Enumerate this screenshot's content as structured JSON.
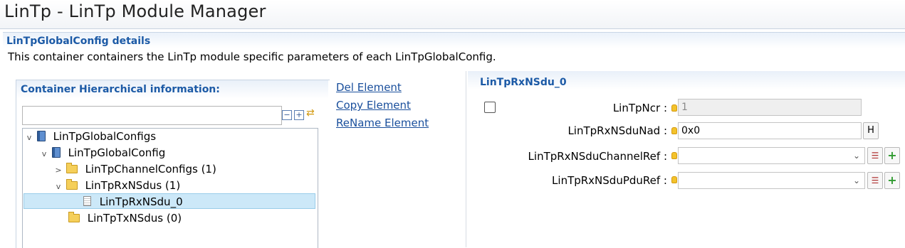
{
  "window": {
    "title": "LinTp - LinTp Module Manager"
  },
  "details": {
    "title": "LinTpGlobalConfig details",
    "description": "This container containers the LinTp module specific parameters of each LinTpGlobalConfig."
  },
  "left_panel": {
    "title": "Container Hierarchical information:",
    "search": {
      "value": "",
      "placeholder": ""
    },
    "tree": [
      {
        "label": "LinTpGlobalConfigs",
        "icon": "book-icon",
        "expanded": true,
        "level": 0
      },
      {
        "label": "LinTpGlobalConfig",
        "icon": "book-icon",
        "expanded": true,
        "level": 1
      },
      {
        "label": "LinTpChannelConfigs (1)",
        "icon": "folder-icon",
        "expanded": false,
        "level": 2
      },
      {
        "label": "LinTpRxNSdus (1)",
        "icon": "folder-icon",
        "expanded": true,
        "level": 2
      },
      {
        "label": "LinTpRxNSdu_0",
        "icon": "document-icon",
        "selected": true,
        "level": 3
      },
      {
        "label": "LinTpTxNSdus (0)",
        "icon": "folder-icon",
        "level": 2
      }
    ]
  },
  "actions": {
    "del": "Del Element",
    "copy": "Copy Element",
    "rename": "ReName Element"
  },
  "right_panel": {
    "title": "LinTpRxNSdu_0",
    "params": {
      "ncr": {
        "label": "LinTpNcr :",
        "value": "1"
      },
      "nad": {
        "label": "LinTpRxNSduNad :",
        "value": "0x0",
        "button": "H"
      },
      "channel_ref": {
        "label": "LinTpRxNSduChannelRef :",
        "value": ""
      },
      "pdu_ref": {
        "label": "LinTpRxNSduPduRef :",
        "value": ""
      }
    }
  },
  "colors": {
    "accent": "#1c5aa6",
    "selection": "#cce8f8",
    "link": "#1a4f9c"
  }
}
